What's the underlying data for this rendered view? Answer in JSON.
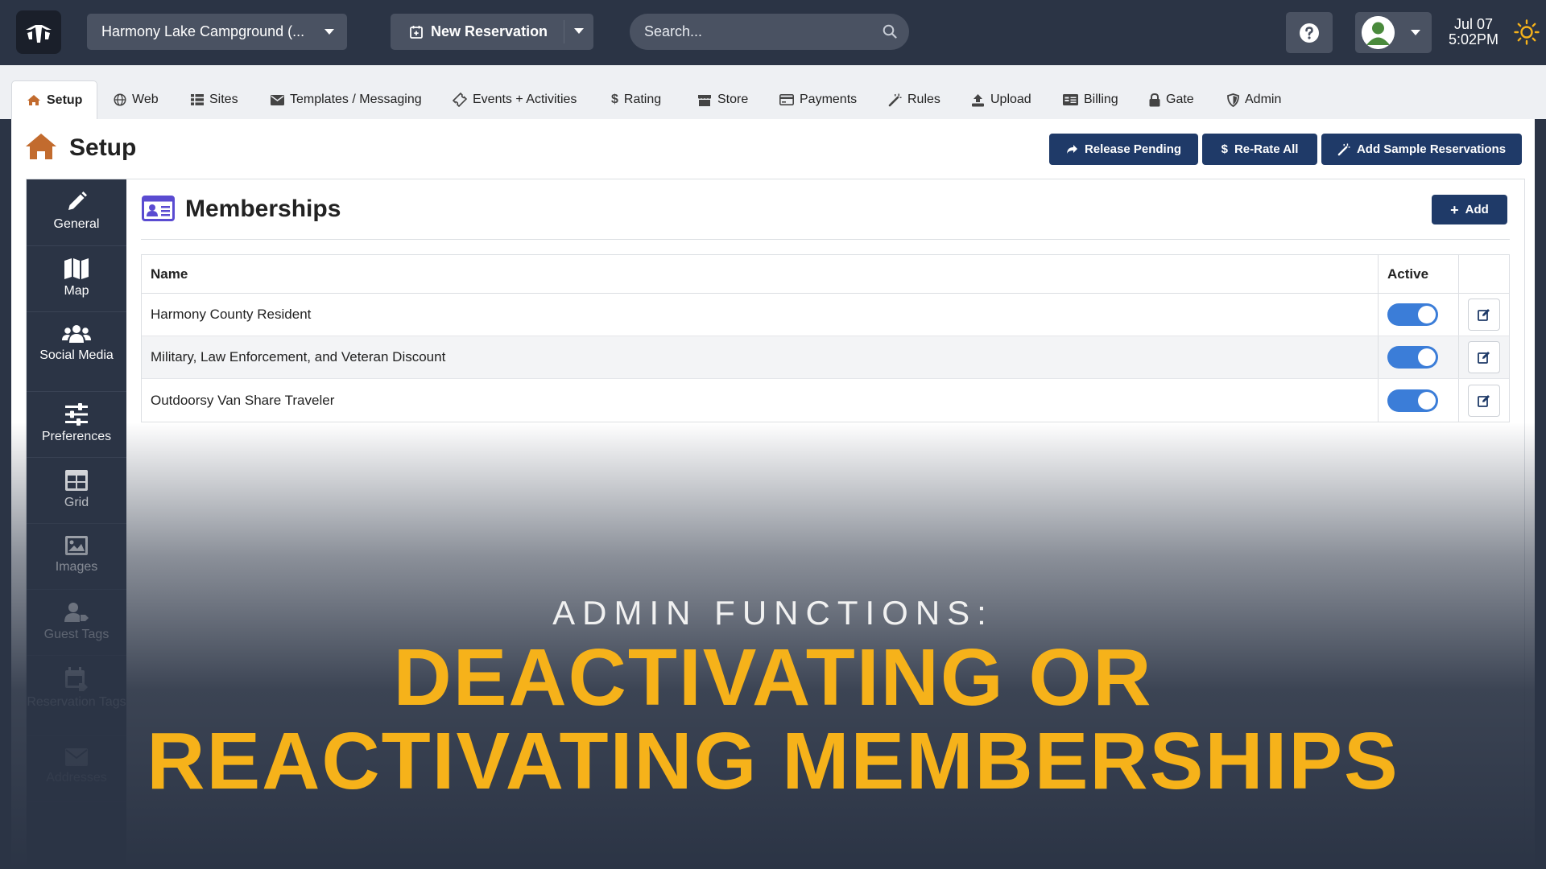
{
  "topbar": {
    "campground": "Harmony Lake Campground (...",
    "new_reservation": "New Reservation",
    "search_placeholder": "Search...",
    "date": "Jul 07",
    "time": "5:02PM"
  },
  "tabs": [
    {
      "label": "Setup",
      "icon": "home-icon"
    },
    {
      "label": "Web",
      "icon": "globe-icon"
    },
    {
      "label": "Sites",
      "icon": "list-icon"
    },
    {
      "label": "Templates / Messaging",
      "icon": "envelope-icon"
    },
    {
      "label": "Events + Activities",
      "icon": "ticket-icon"
    },
    {
      "label": "Rating",
      "icon": "dollar-icon"
    },
    {
      "label": "Store",
      "icon": "store-icon"
    },
    {
      "label": "Payments",
      "icon": "credit-card-icon"
    },
    {
      "label": "Rules",
      "icon": "magic-wand-icon"
    },
    {
      "label": "Upload",
      "icon": "upload-icon"
    },
    {
      "label": "Billing",
      "icon": "billing-icon"
    },
    {
      "label": "Gate",
      "icon": "lock-icon"
    },
    {
      "label": "Admin",
      "icon": "shield-icon"
    }
  ],
  "page": {
    "title": "Setup",
    "buttons": {
      "release_pending": "Release Pending",
      "rerate_all": "Re-Rate All",
      "add_sample": "Add Sample Reservations"
    }
  },
  "sidebar": {
    "items": [
      {
        "label": "General",
        "icon": "pencil-icon"
      },
      {
        "label": "Map",
        "icon": "map-icon"
      },
      {
        "label": "Social Media",
        "icon": "users-icon"
      },
      {
        "label": "Preferences",
        "icon": "sliders-icon"
      },
      {
        "label": "Grid",
        "icon": "grid-icon"
      },
      {
        "label": "Images",
        "icon": "image-icon"
      },
      {
        "label": "Guest Tags",
        "icon": "user-tag-icon"
      },
      {
        "label": "Reservation Tags",
        "icon": "calendar-tag-icon"
      },
      {
        "label": "Addresses",
        "icon": "envelope-icon"
      }
    ]
  },
  "memberships": {
    "title": "Memberships",
    "add_label": "Add",
    "columns": {
      "name": "Name",
      "active": "Active"
    },
    "rows": [
      {
        "name": "Harmony County Resident",
        "active": true
      },
      {
        "name": "Military, Law Enforcement, and Veteran Discount",
        "active": true
      },
      {
        "name": "Outdoorsy Van Share Traveler",
        "active": true
      }
    ]
  },
  "overlay": {
    "subtitle": "ADMIN FUNCTIONS:",
    "line1": "DEACTIVATING OR",
    "line2": "REACTIVATING MEMBERSHIPS"
  },
  "colors": {
    "nav_bg": "#2b3445",
    "primary_button": "#1f3a68",
    "toggle_on": "#3b7dd8",
    "headline": "#f6b21a"
  }
}
